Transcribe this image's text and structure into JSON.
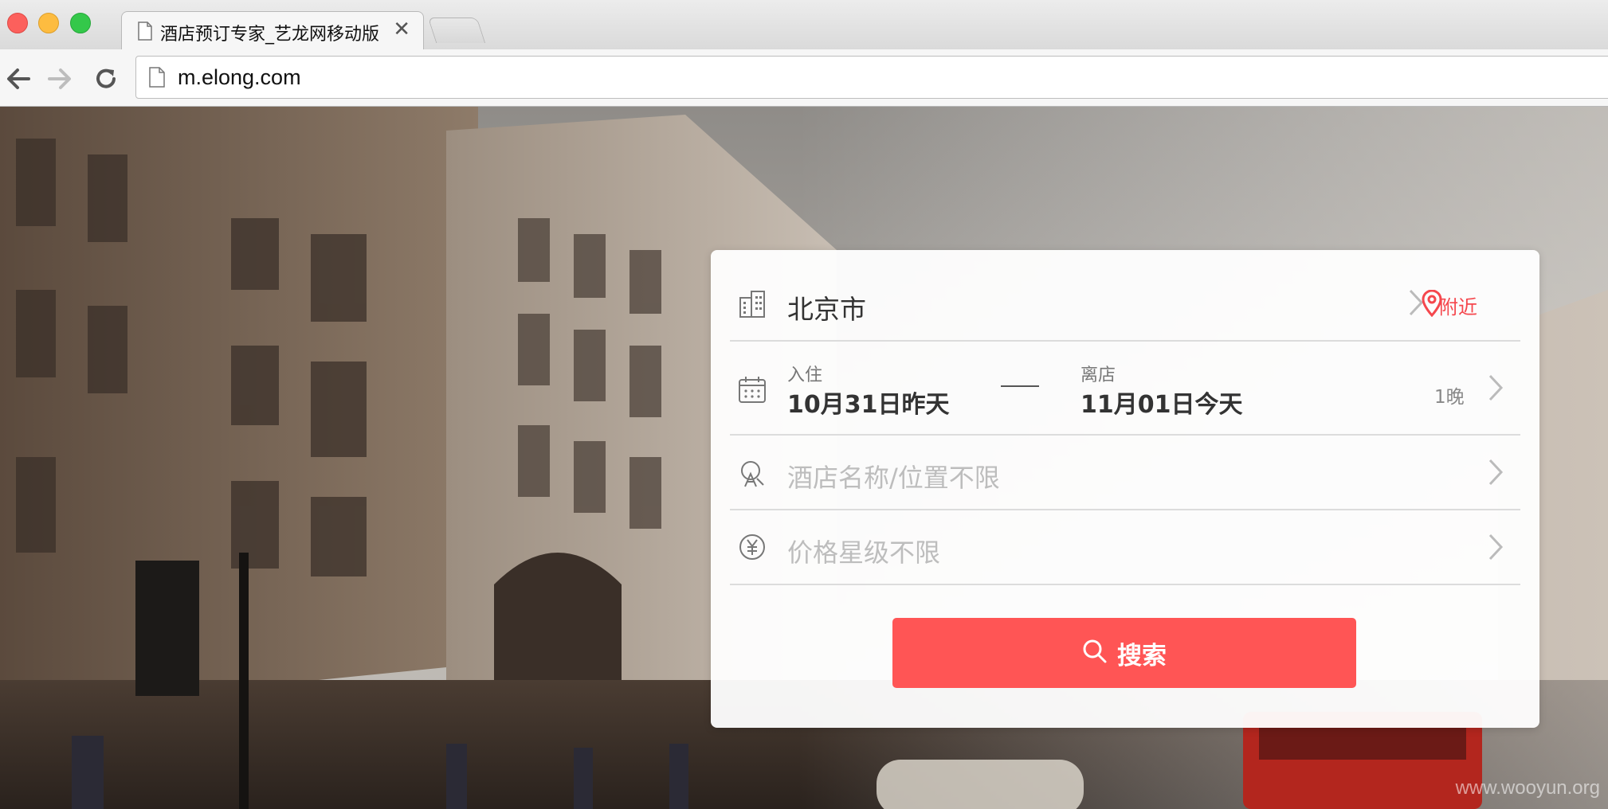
{
  "browser": {
    "tab_title": "酒店预订专家_艺龙网移动版",
    "tab_close": "✕",
    "url": "m.elong.com"
  },
  "search": {
    "city": "北京市",
    "nearby_label": "附近",
    "checkin_label": "入住",
    "checkin_value": "10月31日昨天",
    "checkout_label": "离店",
    "checkout_value": "11月01日今天",
    "nights": "1晚",
    "hotel_placeholder": "酒店名称/位置不限",
    "price_placeholder": "价格星级不限",
    "search_button": "搜索"
  },
  "watermark": "www.wooyun.org",
  "colors": {
    "accent": "#ff5555",
    "nearby": "#f5474d"
  },
  "icons": {
    "city": "building-icon",
    "date": "calendar-icon",
    "hotel": "location-search-icon",
    "price": "yuan-icon",
    "nearby": "map-pin-icon",
    "search": "search-icon"
  }
}
